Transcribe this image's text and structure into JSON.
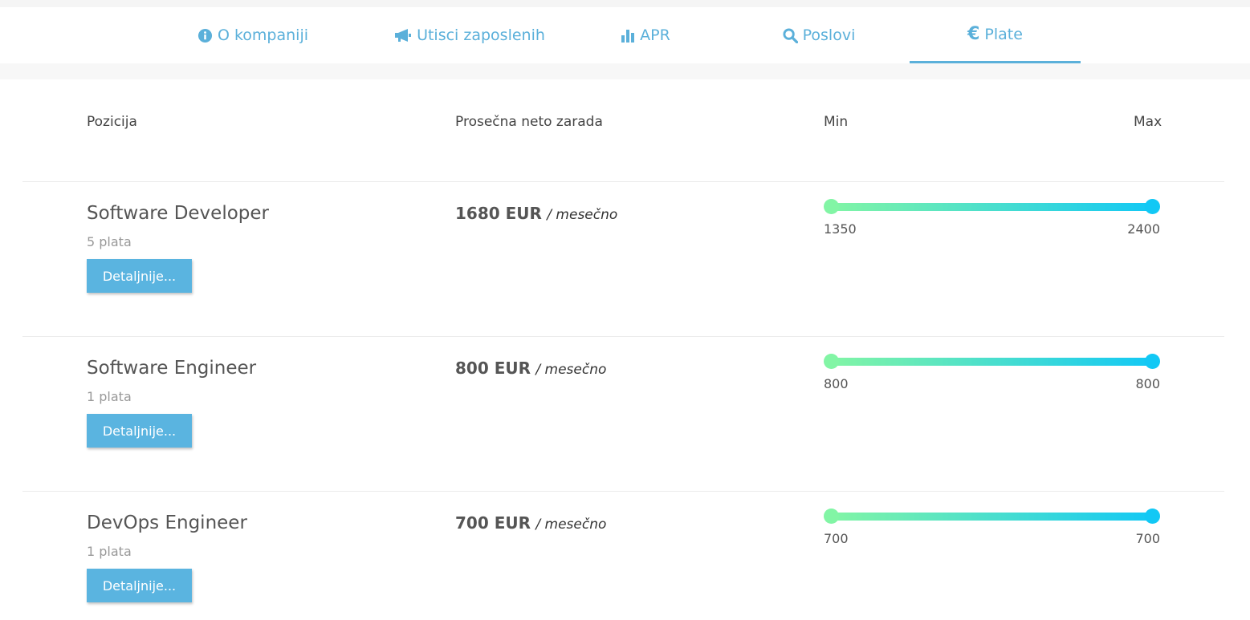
{
  "nav": {
    "tabs": [
      {
        "label": "O kompaniji",
        "icon": "info-circle-icon"
      },
      {
        "label": "Utisci zaposlenih",
        "icon": "megaphone-icon"
      },
      {
        "label": "APR",
        "icon": "bar-chart-icon"
      },
      {
        "label": "Poslovi",
        "icon": "search-icon"
      },
      {
        "label": "Plate",
        "icon": "euro-icon",
        "active": true
      }
    ]
  },
  "table": {
    "headers": {
      "position": "Pozicija",
      "avg": "Prosečna neto zarada",
      "min": "Min",
      "max": "Max"
    },
    "rows": [
      {
        "title": "Software Developer",
        "count": "5 plata",
        "button": "Detaljnije...",
        "avg": "1680 EUR",
        "unit": "/ mesečno",
        "min": "1350",
        "max": "2400"
      },
      {
        "title": "Software Engineer",
        "count": "1 plata",
        "button": "Detaljnije...",
        "avg": "800 EUR",
        "unit": "/ mesečno",
        "min": "800",
        "max": "800"
      },
      {
        "title": "DevOps Engineer",
        "count": "1 plata",
        "button": "Detaljnije...",
        "avg": "700 EUR",
        "unit": "/ mesečno",
        "min": "700",
        "max": "700"
      }
    ]
  },
  "colors": {
    "accent": "#5bb0da",
    "button": "#5ab4e0",
    "gradient_start": "#82f5a5",
    "gradient_end": "#12c8f5"
  }
}
